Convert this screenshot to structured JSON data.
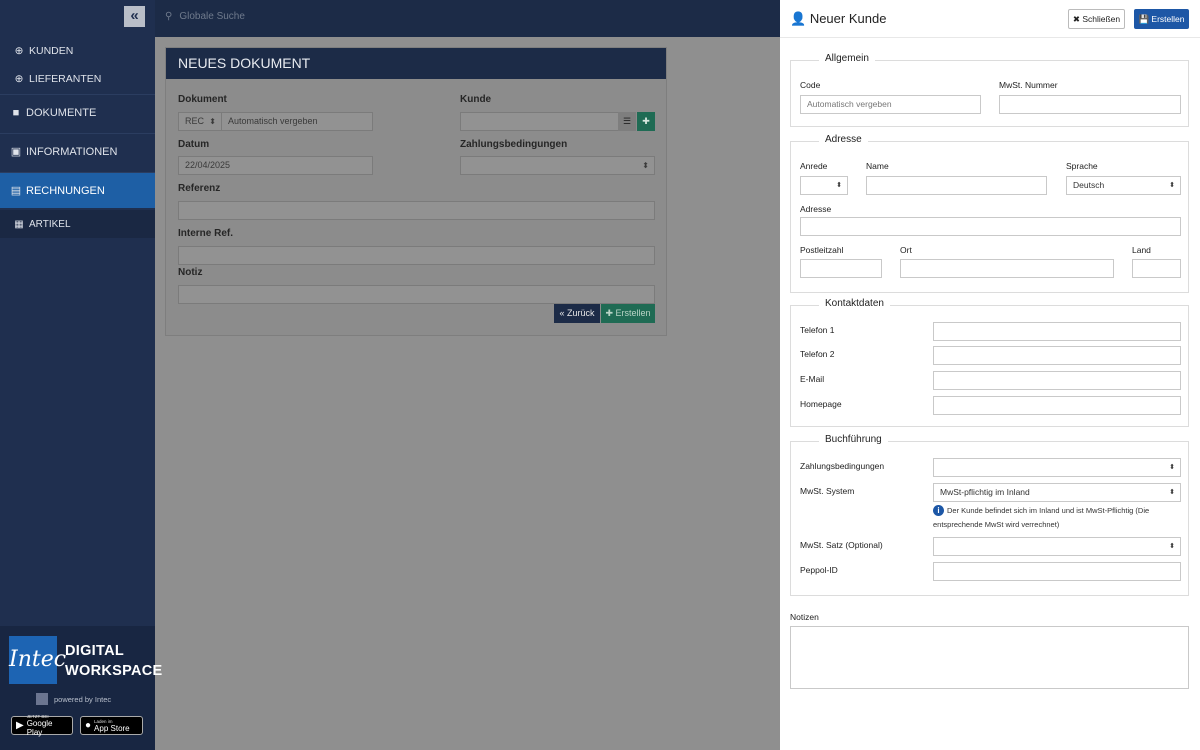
{
  "sidebar": {
    "collapse_icon": "«",
    "items": [
      {
        "label": "KUNDEN",
        "icon": "plus-circle-icon",
        "glyph": "⊕"
      },
      {
        "label": "LIEFERANTEN",
        "icon": "plus-circle-icon",
        "glyph": "⊕"
      },
      {
        "label": "DOKUMENTE",
        "icon": "folder-icon",
        "glyph": "■"
      },
      {
        "label": "INFORMATIONEN",
        "icon": "user-card-icon",
        "glyph": "▣"
      },
      {
        "label": "RECHNUNGEN",
        "icon": "file-icon",
        "glyph": "▤"
      },
      {
        "label": "ARTIKEL",
        "icon": "grid-icon",
        "glyph": "▦"
      }
    ],
    "brand": {
      "logo_text": "Intec",
      "line1": "DIGITAL",
      "line2": "WORKSPACE",
      "powered": "powered by Intec"
    },
    "stores": [
      {
        "small": "JETZT BEI",
        "big": "Google Play",
        "glyph": "▶"
      },
      {
        "small": "Laden im",
        "big": "App Store",
        "glyph": ""
      }
    ]
  },
  "topbar": {
    "search_placeholder": "Globale Suche"
  },
  "document": {
    "title": "NEUES DOKUMENT",
    "labels": {
      "dokument": "Dokument",
      "kunde": "Kunde",
      "datum": "Datum",
      "zahlung": "Zahlungsbedingungen",
      "referenz": "Referenz",
      "interne_ref": "Interne Ref.",
      "notiz": "Notiz"
    },
    "doc_type": "REC",
    "doc_number": "Automatisch vergeben",
    "date": "22/04/2025",
    "back_label": "« Zurück",
    "create_label": "✚ Erstellen"
  },
  "panel": {
    "title": "Neuer Kunde",
    "close_label": "✖ Schließen",
    "create_label": "💾 Erstellen",
    "allgemein": {
      "legend": "Allgemein",
      "code_label": "Code",
      "code_placeholder": "Automatisch vergeben",
      "vat_label": "MwSt. Nummer"
    },
    "adresse": {
      "legend": "Adresse",
      "anrede": "Anrede",
      "name": "Name",
      "sprache": "Sprache",
      "sprache_value": "Deutsch",
      "adresse": "Adresse",
      "plz": "Postleitzahl",
      "ort": "Ort",
      "land": "Land"
    },
    "kontakt": {
      "legend": "Kontaktdaten",
      "tel1": "Telefon 1",
      "tel2": "Telefon 2",
      "email": "E-Mail",
      "homepage": "Homepage"
    },
    "buchhaltung": {
      "legend": "Buchführung",
      "zahlung": "Zahlungsbedingungen",
      "mwst_system": "MwSt. System",
      "mwst_system_value": "MwSt-pflichtig im Inland",
      "hint_line1": "Der Kunde befindet sich im Inland und ist MwSt-Pflichtig (Die",
      "hint_line2": "entsprechende MwSt wird verrechnet)",
      "mwst_satz": "MwSt. Satz (Optional)",
      "peppol": "Peppol-ID"
    },
    "notizen": "Notizen"
  }
}
